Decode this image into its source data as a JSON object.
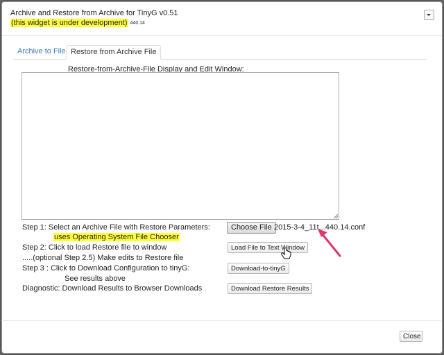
{
  "header": {
    "title": "Archive and Restore from Archive for TinyG v0.51",
    "dev_notice": "(this widget is under development)",
    "version": "440.14"
  },
  "tabs": [
    {
      "label": "Archive to File",
      "active": false
    },
    {
      "label": "Restore from Archive File",
      "active": true
    }
  ],
  "panel": {
    "label": "Restore-from-Archive-File Display and Edit Window:",
    "textarea_value": ""
  },
  "steps": {
    "step1_label": "Step 1: Select an Archive File with Restore Parameters:",
    "step1_note": "uses Operating System File Chooser",
    "choose_file_label": "Choose File",
    "chosen_file": "2015-3-4_11t...440.14.conf",
    "step2_label": "Step 2: Click to load Restore file to window",
    "load_button": "Load File to Text Window",
    "step25_label": ".....(optional Step 2.5) Make edits to Restore file",
    "step3_label": "Step 3 : Click to Download Configuration to tinyG:",
    "download_button": "Download-to-tinyG",
    "results_label": "See results above",
    "diagnostic_label": "Diagnostic: Download Results to Browser Downloads",
    "diagnostic_button": "Download Restore Results"
  },
  "footer": {
    "close_label": "Close"
  },
  "colors": {
    "highlight": "#ffff3a",
    "tab_link": "#3a7dbd",
    "arrow": "#e0336f"
  },
  "icons": {
    "menu": "chevron-down-icon",
    "arrow": "pointer-arrow-icon",
    "cursor": "hand-cursor-icon"
  }
}
